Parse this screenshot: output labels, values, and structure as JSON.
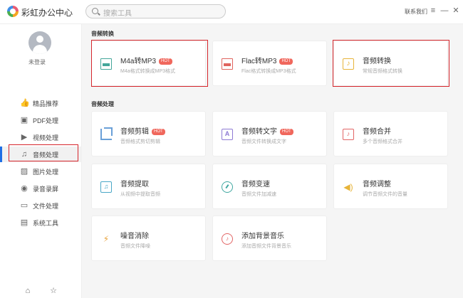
{
  "app": {
    "title": "彩虹办公中心",
    "contact": "联系我们"
  },
  "search": {
    "placeholder": "搜索工具"
  },
  "window_controls": {
    "menu": "≡",
    "minimize": "—",
    "close": "✕"
  },
  "user": {
    "status": "未登录"
  },
  "sidebar": {
    "items": [
      {
        "label": "精品推荐",
        "icon": "thumbs-up-icon",
        "glyph": "👍"
      },
      {
        "label": "PDF处理",
        "icon": "pdf-icon",
        "glyph": "▣"
      },
      {
        "label": "视频处理",
        "icon": "video-icon",
        "glyph": "▶"
      },
      {
        "label": "音频处理",
        "icon": "music-note-icon",
        "glyph": "♫",
        "active": true
      },
      {
        "label": "图片处理",
        "icon": "image-icon",
        "glyph": "▨"
      },
      {
        "label": "录音录屏",
        "icon": "record-icon",
        "glyph": "◉"
      },
      {
        "label": "文件处理",
        "icon": "folder-icon",
        "glyph": "▭"
      },
      {
        "label": "系统工具",
        "icon": "system-tools-icon",
        "glyph": "▤"
      }
    ],
    "bottom": [
      {
        "icon": "home-icon",
        "glyph": "⌂"
      },
      {
        "icon": "star-icon",
        "glyph": "☆"
      }
    ]
  },
  "sections": [
    {
      "title": "音频转换",
      "cards": [
        {
          "title": "M4a转MP3",
          "hot": true,
          "subtitle": "M4a格式转换成MP3格式",
          "icon": "doc-icon",
          "glyph": ""
        },
        {
          "title": "Flac转MP3",
          "hot": true,
          "subtitle": "Flac格式转换成MP3格式",
          "icon": "doc-red-icon",
          "glyph": ""
        },
        {
          "title": "音频转换",
          "hot": false,
          "subtitle": "常规音频格式转换",
          "icon": "note-icon",
          "glyph": "♪"
        }
      ]
    },
    {
      "title": "音频处理",
      "cards": [
        {
          "title": "音频剪辑",
          "hot": true,
          "subtitle": "音频格式剪切剪辑",
          "icon": "crop-icon",
          "glyph": ""
        },
        {
          "title": "音频转文字",
          "hot": true,
          "subtitle": "音频文件转换成文字",
          "icon": "text-icon",
          "glyph": "A"
        },
        {
          "title": "音频合并",
          "hot": false,
          "subtitle": "多个音频格式合并",
          "icon": "merge-icon",
          "glyph": "♪"
        },
        {
          "title": "音频提取",
          "hot": false,
          "subtitle": "从视频中提取音频",
          "icon": "extract-icon",
          "glyph": "♫"
        },
        {
          "title": "音频变速",
          "hot": false,
          "subtitle": "音频文件加减速",
          "icon": "speed-icon",
          "glyph": ""
        },
        {
          "title": "音频调整",
          "hot": false,
          "subtitle": "调节音频文件的音量",
          "icon": "volume-icon",
          "glyph": "◀)"
        },
        {
          "title": "噪音消除",
          "hot": false,
          "subtitle": "音频文件降噪",
          "icon": "noise-icon",
          "glyph": "⚡"
        },
        {
          "title": "添加背景音乐",
          "hot": false,
          "subtitle": "添加音频文件背景音乐",
          "icon": "bgm-icon",
          "glyph": "♪"
        }
      ]
    }
  ],
  "hot_label": "HOT"
}
